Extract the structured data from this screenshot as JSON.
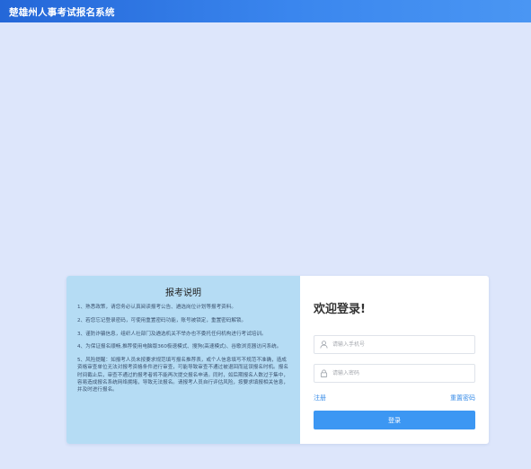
{
  "header": {
    "title": "楚雄州人事考试报名系统"
  },
  "notice": {
    "title": "报考说明",
    "items": [
      "1、熟悉政策，请您务必认真阅读报考公告、遴选岗位计划等报考资料。",
      "2、若您忘记登录密码，可使用重置密码功能，账号被锁定，重置密码解锁。",
      "3、谨防诈骗信息，组织人社部门及遴选机关不举办也不委托任何机构进行考试培训。",
      "4、为保证报名顺畅,推荐使用电脑版360极速模式、搜狗(高速模式)、谷歌浏览器访问系统。",
      "5、风险提醒：如报考人员未按要求规范填写报名推荐表，或个人信息填写不规范不准确，造成资格审查单位无法对报考资格条件进行审查，可能导致审查不通过被退回而延误报名时机。报名时间截止后，审查不通过的报考者将不能再次提交报名申请。同时，如后期报名人数过于集中，容易造成报名系统网络拥堵，导致无法报名。请报考人员自行评估风险，按要求填报相关信息，并及时进行报名。"
    ]
  },
  "login": {
    "welcome": "欢迎登录!",
    "phone_placeholder": "请输入手机号",
    "password_placeholder": "请输入密码",
    "register_label": "注册",
    "reset_label": "重置密码",
    "submit_label": "登录"
  },
  "colors": {
    "page_bg": "#dde6fb",
    "topbar": "#3a86ee",
    "notice_bg": "#b5dcf4",
    "accent": "#3c97f3"
  },
  "icons": {
    "phone_field": "user-icon",
    "password_field": "lock-icon"
  }
}
